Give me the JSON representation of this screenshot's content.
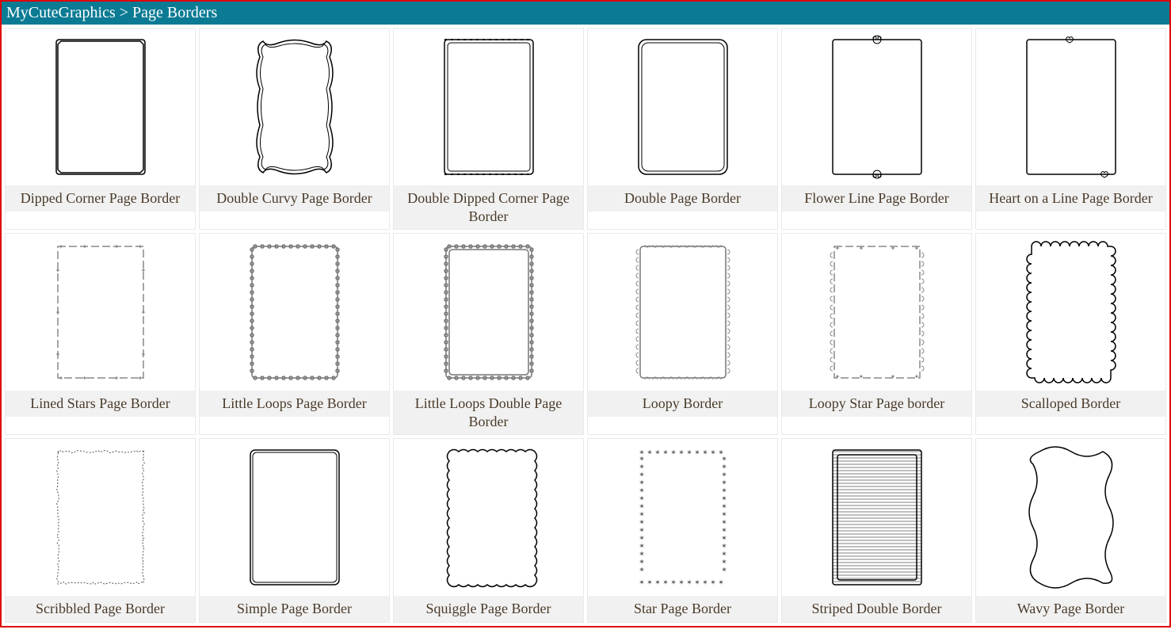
{
  "header": {
    "site": "MyCuteGraphics",
    "sep": " > ",
    "crumb": "Page Borders"
  },
  "items": [
    {
      "label": "Dipped Corner Page Border",
      "svg": "dipped"
    },
    {
      "label": "Double Curvy Page Border",
      "svg": "doublecurvy"
    },
    {
      "label": "Double Dipped Corner Page Border",
      "svg": "doubledipped"
    },
    {
      "label": "Double Page Border",
      "svg": "doublepage"
    },
    {
      "label": "Flower Line Page Border",
      "svg": "flowerline"
    },
    {
      "label": "Heart on a Line Page Border",
      "svg": "heartline"
    },
    {
      "label": "Lined Stars Page Border",
      "svg": "linedstars"
    },
    {
      "label": "Little Loops Page Border",
      "svg": "littleloops"
    },
    {
      "label": "Little Loops Double Page Border",
      "svg": "littleloopsdouble"
    },
    {
      "label": "Loopy Border",
      "svg": "loopy"
    },
    {
      "label": "Loopy Star Page border",
      "svg": "loopystar"
    },
    {
      "label": "Scalloped Border",
      "svg": "scalloped"
    },
    {
      "label": "Scribbled Page Border",
      "svg": "scribbled"
    },
    {
      "label": "Simple Page Border",
      "svg": "simple"
    },
    {
      "label": "Squiggle Page Border",
      "svg": "squiggle"
    },
    {
      "label": "Star Page Border",
      "svg": "star"
    },
    {
      "label": "Striped Double Border",
      "svg": "stripeddouble"
    },
    {
      "label": "Wavy Page Border",
      "svg": "wavy"
    }
  ]
}
